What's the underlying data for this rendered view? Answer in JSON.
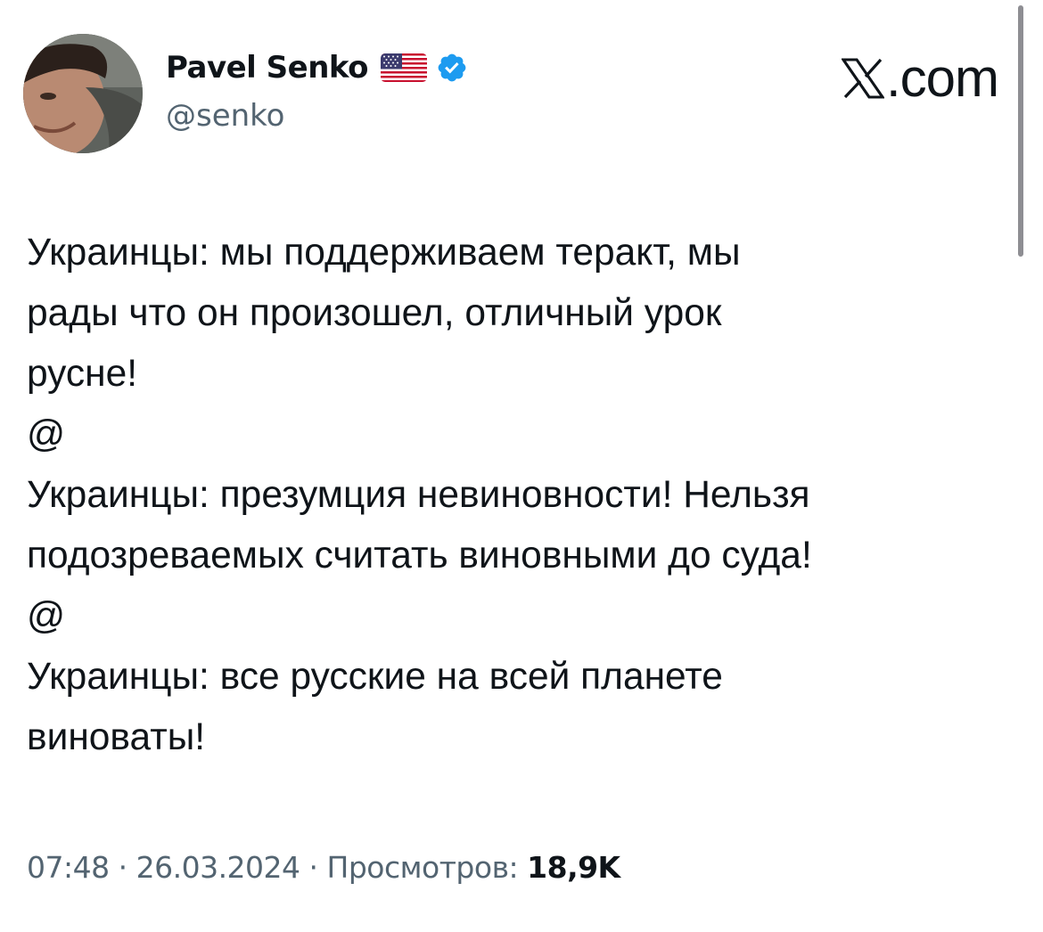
{
  "author": {
    "display_name": "Pavel Senko",
    "handle": "@senko",
    "verified": true
  },
  "brand": {
    "logo_text": ".com"
  },
  "tweet": {
    "lines": [
      "Украинцы: мы поддерживаем теракт, мы",
      "рады что он произошел, отличный урок",
      "русне!",
      "@",
      "Украинцы: презумция невиновности! Нельзя",
      "подозреваемых считать виновными до суда!",
      "@",
      "Украинцы: все русские на всей планете",
      "виноваты!"
    ]
  },
  "meta": {
    "time": "07:48",
    "separator": " · ",
    "date": "26.03.2024",
    "views_label": "Просмотров: ",
    "views_count": "18,9K"
  },
  "icons": {
    "avatar": "avatar-photo",
    "flag": "us-flag-icon",
    "verified": "verified-badge-icon",
    "logo": "x-logo-icon"
  },
  "colors": {
    "text_primary": "#0f1419",
    "text_secondary": "#536471",
    "verified_blue": "#1d9bf0",
    "background": "#ffffff"
  }
}
